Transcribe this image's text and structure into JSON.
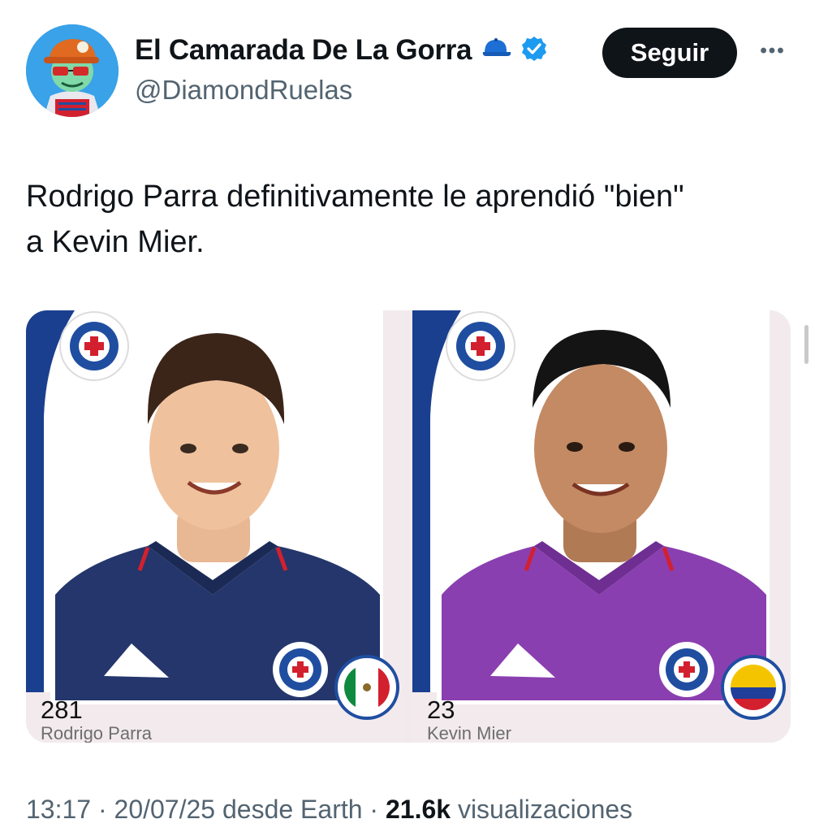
{
  "author": {
    "display_name": "El Camarada De La Gorra",
    "handle": "@DiamondRuelas",
    "verified": true,
    "name_emoji_icon": "blue-cap-icon",
    "verified_icon": "verified-badge-icon"
  },
  "actions": {
    "follow_label": "Seguir",
    "more_label": "•••"
  },
  "tweet": {
    "text_line1": "Rodrigo Parra definitivamente le aprendió \"bien\"",
    "text_line2": "a Kevin Mier."
  },
  "media": {
    "cards": [
      {
        "number": "281",
        "name": "Rodrigo Parra",
        "jersey_color": "#24366b",
        "flag": "mexico-flag-icon"
      },
      {
        "number": "23",
        "name": "Kevin Mier",
        "jersey_color": "#8a3fb0",
        "flag": "colombia-flag-icon"
      }
    ]
  },
  "meta": {
    "time": "13:17",
    "date": "20/07/25",
    "source": "desde Earth",
    "separator": "·",
    "views_count": "21.6k",
    "views_label": "visualizaciones"
  },
  "colors": {
    "follow_bg": "#0f1419",
    "verified": "#1d9bf0",
    "secondary_text": "#536471",
    "club_blue": "#1f4ea1",
    "club_red": "#d3202f"
  }
}
